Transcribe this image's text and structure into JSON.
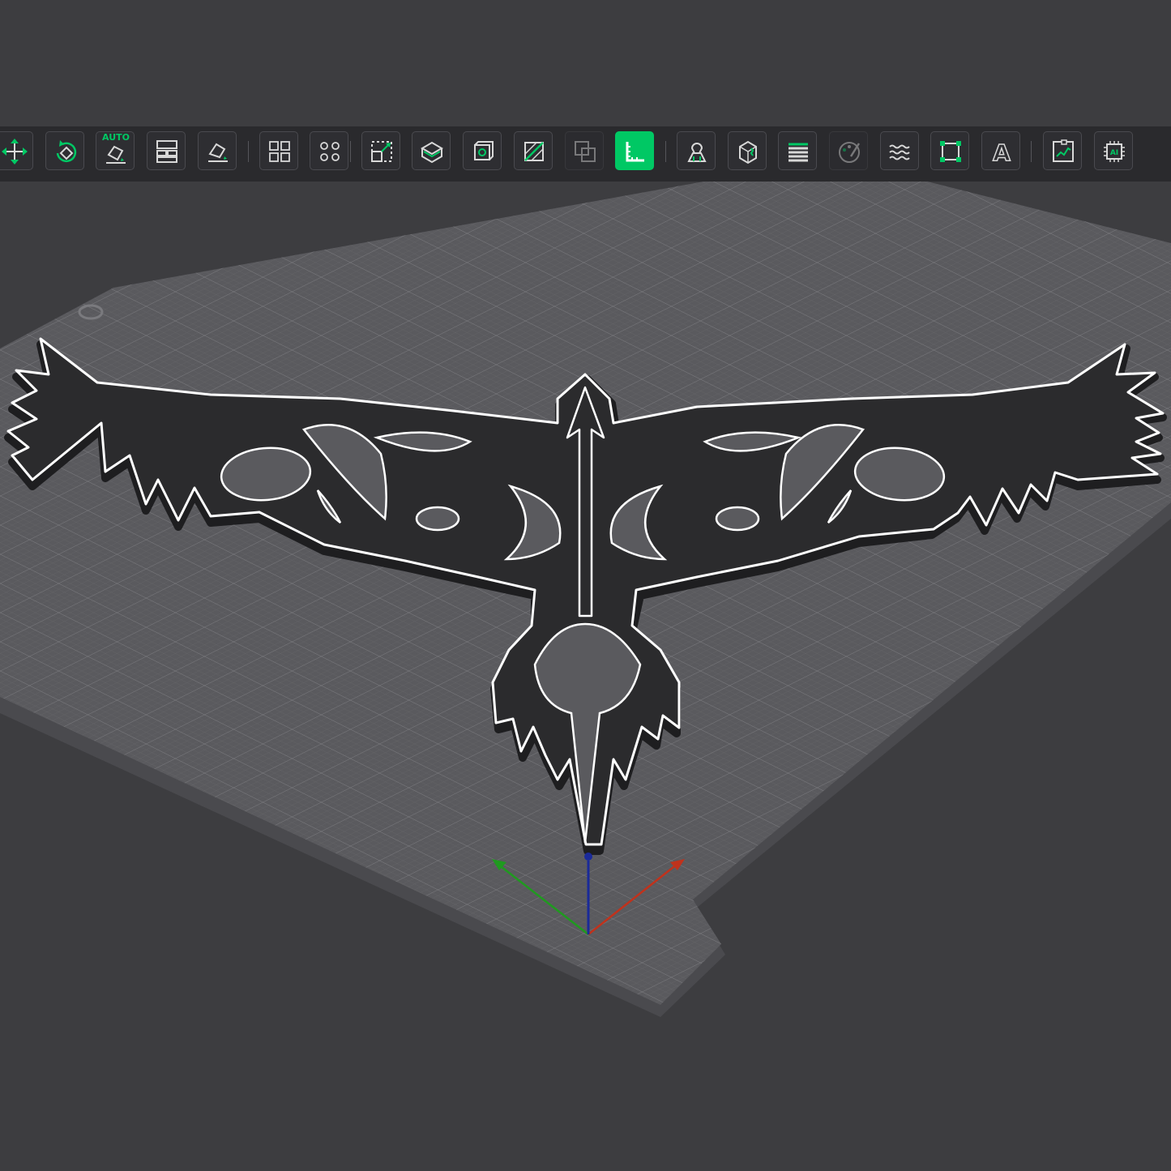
{
  "app": {
    "accent_color": "#00c864",
    "background_color": "#3d3d40",
    "plate_color": "#5a5a5e",
    "model_color": "#2b2b2d"
  },
  "toolbar": {
    "tools": [
      {
        "name": "move",
        "icon": "move-icon"
      },
      {
        "name": "rotate",
        "icon": "rotate-icon"
      },
      {
        "name": "auto-orient",
        "icon": "auto-orient-icon",
        "badge": "AUTO"
      },
      {
        "name": "arrange",
        "icon": "arrange-icon"
      },
      {
        "name": "lay-on-face",
        "icon": "lay-on-face-icon"
      },
      {
        "name": "split-to-objects",
        "icon": "split-objects-icon"
      },
      {
        "name": "split-to-parts",
        "icon": "split-parts-icon"
      },
      {
        "name": "scale",
        "icon": "scale-icon"
      },
      {
        "name": "cut",
        "icon": "cut-icon"
      },
      {
        "name": "variable-layer-height",
        "icon": "layer-height-icon"
      },
      {
        "name": "cut-plane",
        "icon": "cut-plane-icon"
      },
      {
        "name": "boolean",
        "icon": "boolean-icon"
      },
      {
        "name": "measure",
        "icon": "measure-icon",
        "active": true
      },
      {
        "name": "support-paint",
        "icon": "support-paint-icon"
      },
      {
        "name": "seam-paint",
        "icon": "seam-paint-icon"
      },
      {
        "name": "layer-stack",
        "icon": "layer-stack-icon"
      },
      {
        "name": "color-paint",
        "icon": "color-paint-icon"
      },
      {
        "name": "fuzzy-skin",
        "icon": "fuzzy-skin-icon"
      },
      {
        "name": "simplify",
        "icon": "simplify-icon"
      },
      {
        "name": "text",
        "icon": "text-icon",
        "glyph": "A"
      },
      {
        "name": "assembly",
        "icon": "assembly-icon"
      },
      {
        "name": "ai-assistant",
        "icon": "ai-chip-icon",
        "glyph": "AI"
      }
    ]
  },
  "scene": {
    "axes": [
      "x-axis",
      "y-axis",
      "z-axis"
    ],
    "axis_colors": {
      "x": "#c0321c",
      "y": "#1f9a1f",
      "z": "#1a2a9a"
    }
  }
}
